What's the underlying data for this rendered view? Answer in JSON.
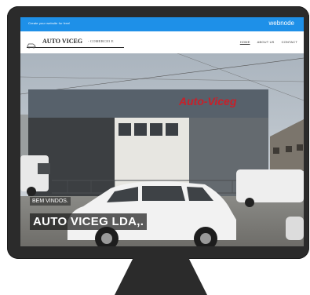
{
  "webnode_bar": {
    "promo": "Create your website for free!",
    "brand": "webnode"
  },
  "site": {
    "logo_name": "AUTO VICEG",
    "logo_sub": "- COMERCIO E"
  },
  "nav": {
    "items": [
      "HOME",
      "ABOUT US",
      "CONTACT"
    ],
    "active": "HOME"
  },
  "hero": {
    "building_sign": "Auto-Viceg",
    "welcome": "BEM VINDOS.",
    "company": "AUTO VICEG LDA,."
  },
  "colors": {
    "webnode_bar": "#1e90e8",
    "monitor": "#2b2b2b",
    "sign": "#c8202a"
  },
  "icons": {
    "logo_mark": "car-icon"
  }
}
